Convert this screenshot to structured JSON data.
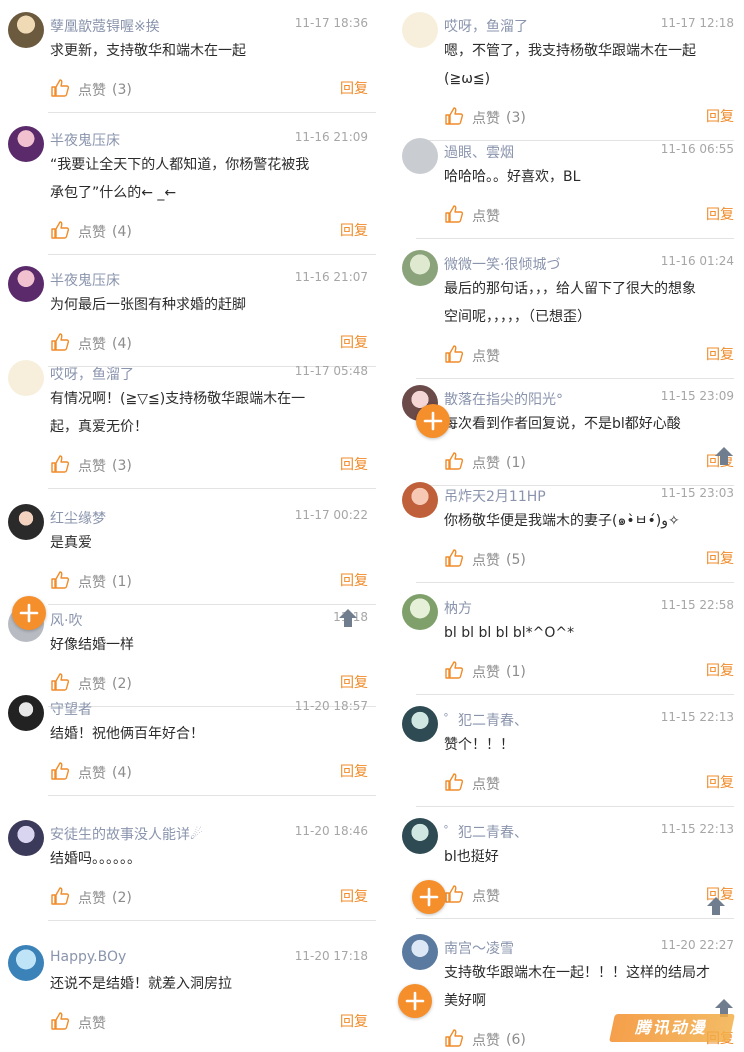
{
  "like_label": "点赞",
  "reply_label": "回复",
  "colors": {
    "accent": "#f08c2a",
    "username": "#8a94ad",
    "fab": "#f48f2c"
  },
  "left": [
    {
      "user": "孽凰歆蔻锝喔※挨",
      "time": "11-17 18:36",
      "lines": [
        "求更新，支持敬华和端木在一起"
      ],
      "likes": "(3)"
    },
    {
      "user": "半夜鬼压床",
      "time": "11-16 21:09",
      "lines": [
        "“我要让全天下的人都知道，你杨警花被我",
        "承包了”什么的← _←"
      ],
      "likes": "(4)"
    },
    {
      "user": "半夜鬼压床",
      "time": "11-16 21:07",
      "lines": [
        "为何最后一张图有种求婚的赶脚"
      ],
      "likes": "(4)"
    },
    {
      "user": "哎呀，鱼溜了",
      "time": "11-17 05:48",
      "lines": [
        "有情况啊！(≧▽≦)支持杨敬华跟端木在一",
        "起，真爱无价！"
      ],
      "likes": "(3)"
    },
    {
      "user": "红尘缘梦",
      "time": "11-17 00:22",
      "lines": [
        "是真爱"
      ],
      "likes": "(1)"
    },
    {
      "user": "风·吹",
      "time": "11-18",
      "lines": [
        "好像结婚一样"
      ],
      "likes": "(2)"
    },
    {
      "user": "守望者",
      "time": "11-20 18:57",
      "lines": [
        "结婚！祝他俩百年好合！"
      ],
      "likes": "(4)"
    },
    {
      "user": "安徒生的故事没人能详☄",
      "time": "11-20 18:46",
      "lines": [
        "结婚吗。。。。。。"
      ],
      "likes": "(2)"
    },
    {
      "user": "Happy.BOy",
      "time": "11-20 17:18",
      "lines": [
        "还说不是结婚！就差入洞房拉"
      ],
      "likes": ""
    }
  ],
  "right": [
    {
      "user": "哎呀，鱼溜了",
      "time": "11-17 12:18",
      "lines": [
        "嗯，不管了，我支持杨敬华跟端木在一起",
        "(≧ω≦)"
      ],
      "likes": "(3)"
    },
    {
      "user": "過眼、雲烟",
      "time": "11-16 06:55",
      "lines": [
        "哈哈哈。。好喜欢，BL"
      ],
      "likes": ""
    },
    {
      "user": "微微一笑·很倾城づ",
      "time": "11-16 01:24",
      "lines": [
        "最后的那句话，，，给人留下了很大的想象",
        "空间呢，，，，，（已想歪）"
      ],
      "likes": ""
    },
    {
      "user": "散落在指尖的阳光°",
      "time": "11-15 23:09",
      "lines": [
        "每次看到作者回复说，不是bl都好心酸"
      ],
      "likes": "(1)"
    },
    {
      "user": "吊炸天2月11HP",
      "time": "11-15 23:03",
      "lines": [
        "你杨敬华便是我端木的妻子(๑•̀ㅂ•́)و✧"
      ],
      "likes": "(5)"
    },
    {
      "user": "枘方",
      "time": "11-15 22:58",
      "lines": [
        "bl bl bl bl bl*^O^*"
      ],
      "likes": "(1)"
    },
    {
      "user": "゜犯二青春、",
      "time": "11-15 22:13",
      "lines": [
        "赞个！！！"
      ],
      "likes": ""
    },
    {
      "user": "゜犯二青春、",
      "time": "11-15 22:13",
      "lines": [
        "bl也挺好"
      ],
      "likes": ""
    },
    {
      "user": "南宫～凌雪",
      "time": "11-20 22:27",
      "lines": [
        "支持敬华跟端木在一起！！！这样的结局才",
        "美好啊"
      ],
      "likes": "(6)"
    }
  ],
  "watermark": "腾讯动漫"
}
